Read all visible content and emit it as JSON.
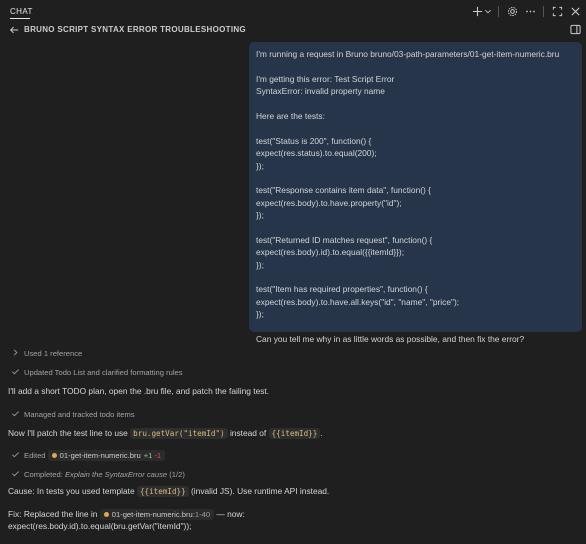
{
  "panel": {
    "tab_label": "CHAT"
  },
  "session": {
    "title": "BRUNO SCRIPT SYNTAX ERROR TROUBLESHOOTING"
  },
  "toolbar_icons": [
    "plus-icon",
    "chevron-down-icon",
    "gear-icon",
    "more-icon",
    "maximize-icon",
    "close-icon",
    "panel-layout-icon",
    "arrow-left-icon"
  ],
  "user_message": {
    "lines": [
      "I'm running a request in Bruno bruno/03-path-parameters/01-get-item-numeric.bru",
      "",
      "I'm getting this error: Test Script Error",
      "SyntaxError: invalid property name",
      "",
      "Here are the tests:",
      "",
      "test(\"Status is 200\", function() {",
      "expect(res.status).to.equal(200);",
      "});",
      "",
      "test(\"Response contains item data\", function() {",
      "expect(res.body).to.have.property(\"id\");",
      "});",
      "",
      "test(\"Returned ID matches request\", function() {",
      "expect(res.body).id).to.equal({{itemId}});",
      "});",
      "",
      "test(\"Item has required properties\", function() {",
      "expect(res.body).to.have.all.keys(\"id\", \"name\", \"price\");",
      "});",
      "",
      "Can you tell me why in as little words as possible, and then fix the error?"
    ]
  },
  "response": {
    "used_reference": "Used 1 reference",
    "todo_updated": "Updated Todo List and clarified formatting rules",
    "plan_text": "I'll add a short TODO plan, open the .bru file, and patch the failing test.",
    "managed_todos": "Managed and tracked todo items",
    "patch_prefix": "Now I'll patch the test line to use",
    "patch_code_1": "bru.getVar(\"itemId\")",
    "patch_middle": "instead of",
    "patch_code_2": "{{itemId}}",
    "patch_suffix": ".",
    "edited_label": "Edited",
    "edited_file": "01-get-item-numeric.bru",
    "edited_added": "+1",
    "edited_removed": "-1",
    "completed_label": "Completed:",
    "completed_task": "Explain the SyntaxError cause",
    "completed_count": "(1/2)",
    "cause_prefix": "Cause: In tests you used template",
    "cause_code": "{{itemId}}",
    "cause_suffix": "(invalid JS). Use runtime API instead.",
    "fix_prefix": "Fix: Replaced the line in",
    "fix_file": "01-get-item-numeric.bru",
    "fix_range": ":1-40",
    "fix_suffix": "— now:",
    "fix_code_line": "expect(res.body.id).to.equal(bru.getVar(\"itemId\"));"
  }
}
